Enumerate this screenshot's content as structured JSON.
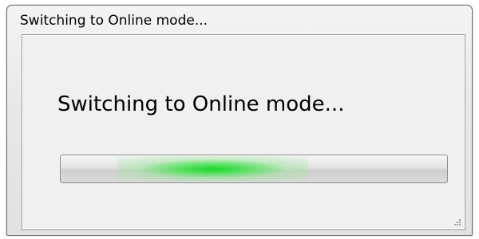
{
  "window": {
    "title": "Switching to Online mode..."
  },
  "dialog": {
    "message": "Switching to Online mode...",
    "progress": {
      "style": "marquee",
      "accent_color": "#1AD628"
    }
  },
  "icons": {
    "resize_grip": "resize-grip-icon"
  }
}
